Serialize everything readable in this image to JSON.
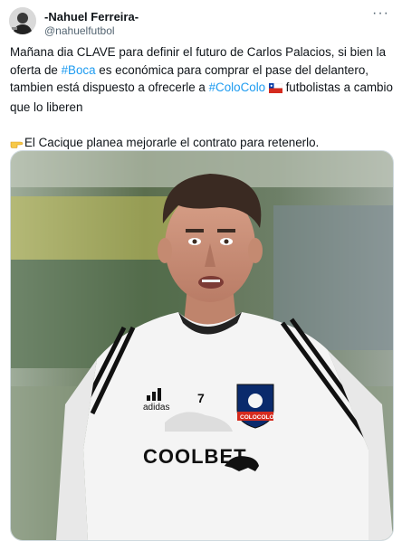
{
  "author": {
    "name": "-Nahuel Ferreira-",
    "handle": "@nahuelfutbol",
    "more_icon": "more-horizontal-icon"
  },
  "tweet": {
    "para1_a": "Mañana dia CLAVE para definir el futuro de Carlos Palacios, si bien la oferta de ",
    "hashtag_boca": "#Boca",
    "para1_b": " es económica para comprar el pase del delantero, tambien está dispuesto a ofrecerle a ",
    "hashtag_colocolo": "#ColoColo",
    "para1_c": " futbolistas a cambio que lo liberen",
    "para2_emoji": "pointing-right-hand-icon",
    "para2_text": "El Cacique planea mejorarle el contrato para retenerlo."
  },
  "media": {
    "description_icon": "football-player-photo",
    "shirt_number": "7",
    "badge_text": "COLOCOLO",
    "sponsor_text": "COOLBET",
    "kit_brand": "adidas"
  },
  "colors": {
    "link": "#1d9bf0",
    "text": "#0f1419",
    "muted": "#536471"
  }
}
